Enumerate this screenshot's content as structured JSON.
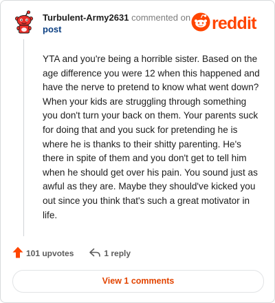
{
  "comment": {
    "username": "Turbulent-Army2631",
    "action_text": "commented on",
    "post_link": "post",
    "body": "YTA and you're being a horrible sister. Based on the age difference you were 12 when this happened and have the nerve to pretend to know what went down? When your kids are struggling through something you don't turn your back on them. Your parents suck for doing that and you suck for pretending he is where he is thanks to their shitty parenting. He's there in spite of them and you don't get to tell him when he should get over his pain. You sound just as awful as they are. Maybe they should've kicked you out since you think that's such a great motivator in life."
  },
  "brand": {
    "wordmark": "reddit",
    "icon": "reddit-snoo-icon",
    "color": "#ff4500"
  },
  "avatar": {
    "icon": "snoo-avatar-icon",
    "color": "#e8302a"
  },
  "actions": {
    "upvotes_label": "101 upvotes",
    "upvote_icon": "upvote-arrow-icon",
    "upvote_color": "#ff4500",
    "reply_label": "1 reply",
    "reply_icon": "reply-arrow-icon"
  },
  "view_comments": {
    "label": "View 1 comments",
    "color": "#e24400"
  }
}
